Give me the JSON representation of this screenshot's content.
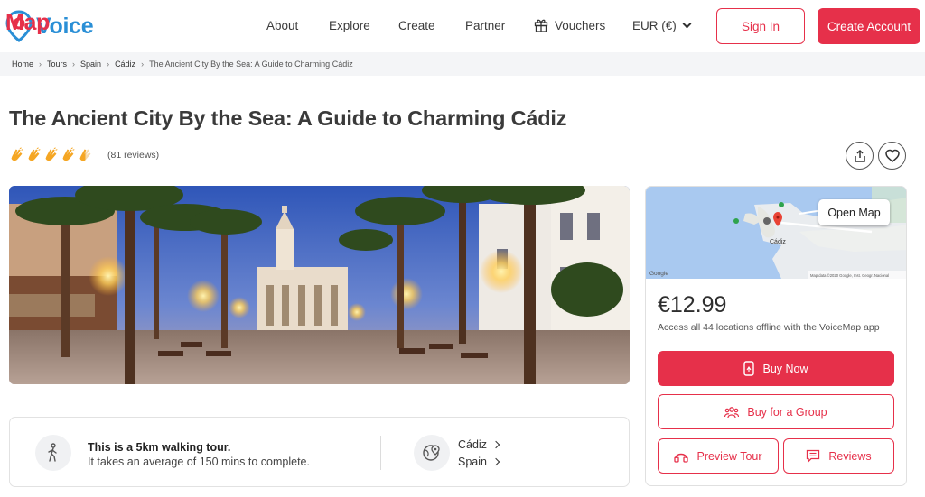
{
  "brand": {
    "voice": "Voice",
    "map": "Map",
    "accent": "#e6304a",
    "blue": "#2a8fd6"
  },
  "nav": {
    "about": "About",
    "explore": "Explore",
    "create": "Create",
    "partner": "Partner",
    "vouchers": "Vouchers",
    "currency": "EUR (€)",
    "sign_in": "Sign In",
    "create_account": "Create Account"
  },
  "breadcrumb": [
    "Home",
    "Tours",
    "Spain",
    "Cádiz",
    "The Ancient City By the Sea: A Guide to Charming Cádiz"
  ],
  "tour": {
    "title": "The Ancient City By the Sea: A Guide to Charming Cádiz",
    "rating_icons": 5,
    "reviews": "(81 reviews)"
  },
  "info": {
    "walking": "This is a 5km walking tour.",
    "duration": "It takes an average of 150 mins to complete.",
    "city": "Cádiz",
    "country": "Spain"
  },
  "purchase": {
    "open_map": "Open Map",
    "map_labels": {
      "city": "Cádiz",
      "google": "Google",
      "copyright": "Map data ©2020 Google, Inst. Geogr. Nacional"
    },
    "price": "€12.99",
    "note": "Access all 44 locations offline with the VoiceMap app",
    "buy_now": "Buy Now",
    "buy_group": "Buy for a Group",
    "preview": "Preview Tour",
    "reviews": "Reviews"
  }
}
